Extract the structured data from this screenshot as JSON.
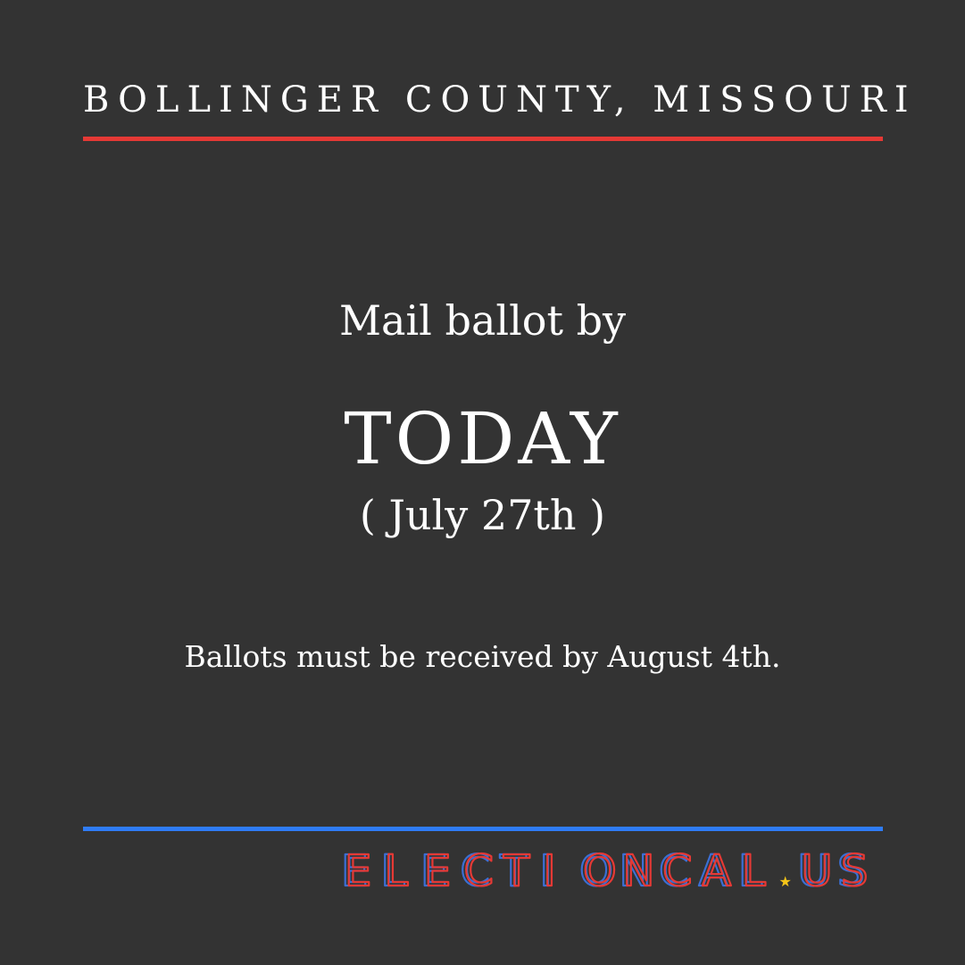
{
  "header": {
    "title": "BOLLINGER COUNTY, MISSOURI",
    "rule_color": "#e53935"
  },
  "main": {
    "subtitle": "Mail ballot by",
    "headline": "TODAY",
    "date": "( July 27th )",
    "note": "Ballots must be received by August 4th."
  },
  "footer": {
    "rule_color": "#2f7cf6",
    "logo_text": "ELECTIONCAL.US",
    "logo_colors": {
      "red": "#e53935",
      "blue": "#3b6fd4",
      "star": "#f5c518"
    }
  }
}
